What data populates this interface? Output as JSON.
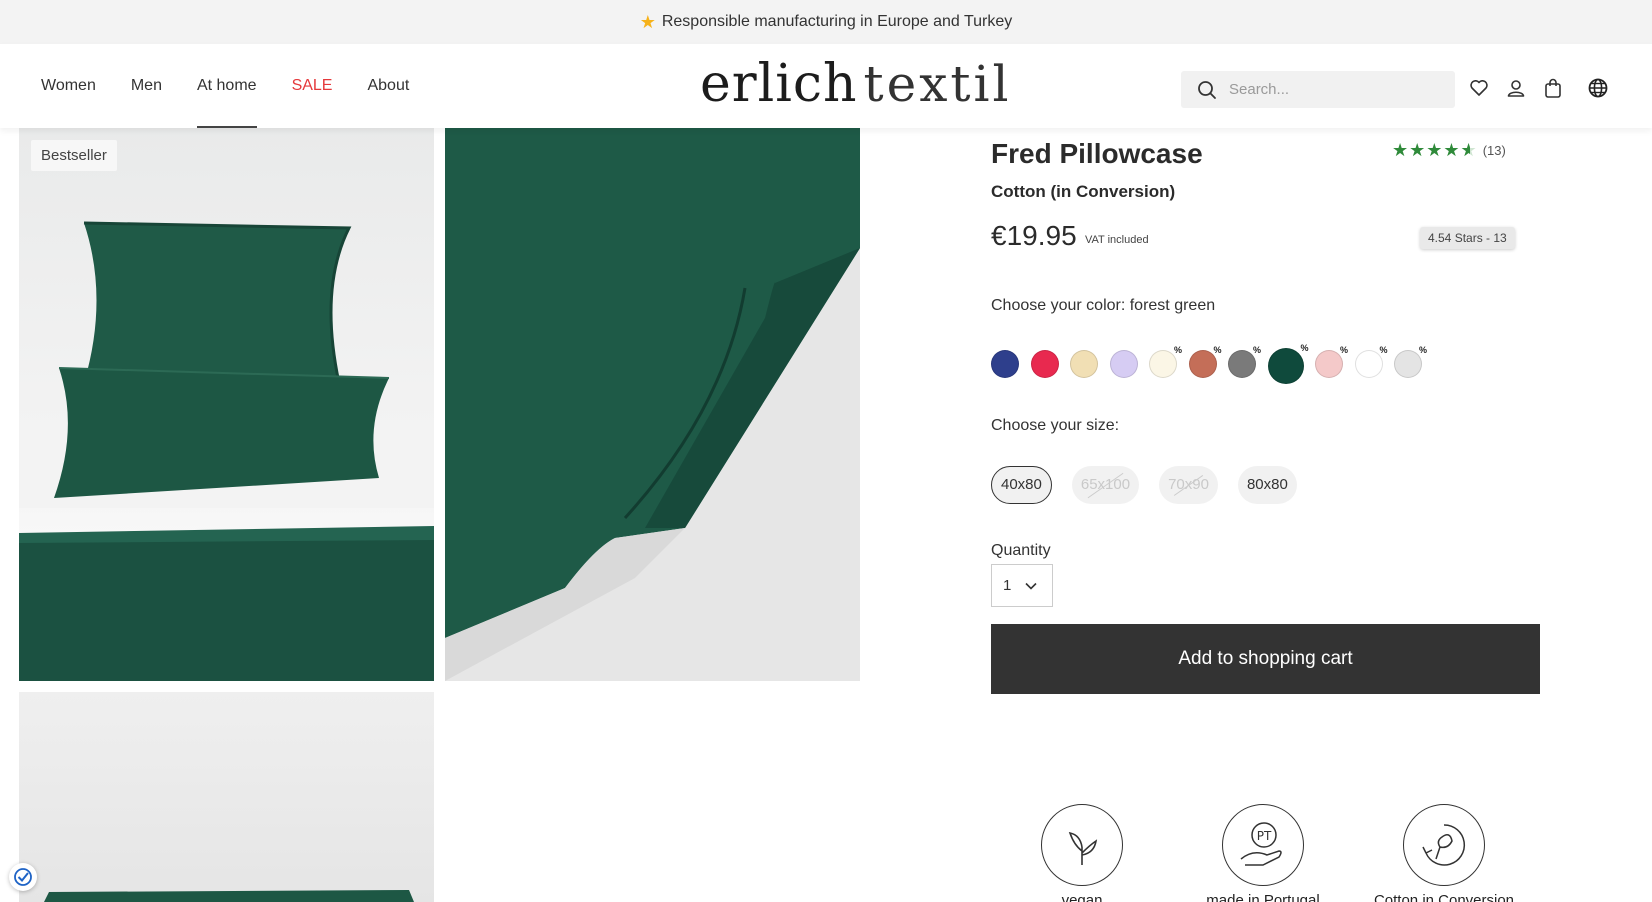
{
  "announcement": {
    "icon": "star-icon",
    "text": "Responsible manufacturing in Europe and Turkey"
  },
  "nav": {
    "women": "Women",
    "men": "Men",
    "home": "At home",
    "sale": "SALE",
    "about": "About"
  },
  "logo": {
    "part1": "erlich",
    "part2": "textil"
  },
  "search": {
    "placeholder": "Search..."
  },
  "header_icons": [
    "heart-icon",
    "user-icon",
    "bag-icon",
    "globe-icon"
  ],
  "gallery": {
    "badge": "Bestseller"
  },
  "product": {
    "title": "Fred Pillowcase",
    "subtitle": "Cotton (in Conversion)",
    "rating_count": "(13)",
    "rating_value": 4.54,
    "price": "€19.95",
    "vat": "VAT included",
    "rating_tooltip": "4.54 Stars - 13"
  },
  "colors": {
    "label": "Choose your color: forest green",
    "swatches": [
      {
        "color": "#2e3f8c",
        "sale": false,
        "selected": false
      },
      {
        "color": "#e8294f",
        "sale": false,
        "selected": false
      },
      {
        "color": "#f1dfb4",
        "sale": false,
        "selected": false
      },
      {
        "color": "#d6ccf3",
        "sale": false,
        "selected": false
      },
      {
        "color": "#fbf6e6",
        "sale": true,
        "selected": false
      },
      {
        "color": "#c46e58",
        "sale": true,
        "selected": false
      },
      {
        "color": "#7a7a7a",
        "sale": true,
        "selected": false
      },
      {
        "color": "#0f4a3c",
        "sale": true,
        "selected": true
      },
      {
        "color": "#f4c9c9",
        "sale": true,
        "selected": false
      },
      {
        "color": "#ffffff",
        "sale": true,
        "selected": false
      },
      {
        "color": "#e4e4e4",
        "sale": true,
        "selected": false
      }
    ],
    "sale_mark": "%"
  },
  "sizes": {
    "label": "Choose your size:",
    "options": [
      {
        "label": "40x80",
        "selected": true,
        "available": true
      },
      {
        "label": "65x100",
        "selected": false,
        "available": false
      },
      {
        "label": "70x90",
        "selected": false,
        "available": false
      },
      {
        "label": "80x80",
        "selected": false,
        "available": true
      }
    ]
  },
  "quantity": {
    "label": "Quantity",
    "value": "1"
  },
  "cart_button": "Add to shopping cart",
  "features": [
    {
      "icon": "leaves-icon",
      "label": "vegan"
    },
    {
      "icon": "hand-portugal-icon",
      "label": "made in Portugal"
    },
    {
      "icon": "cotton-icon",
      "label": "Cotton in Conversion"
    }
  ]
}
